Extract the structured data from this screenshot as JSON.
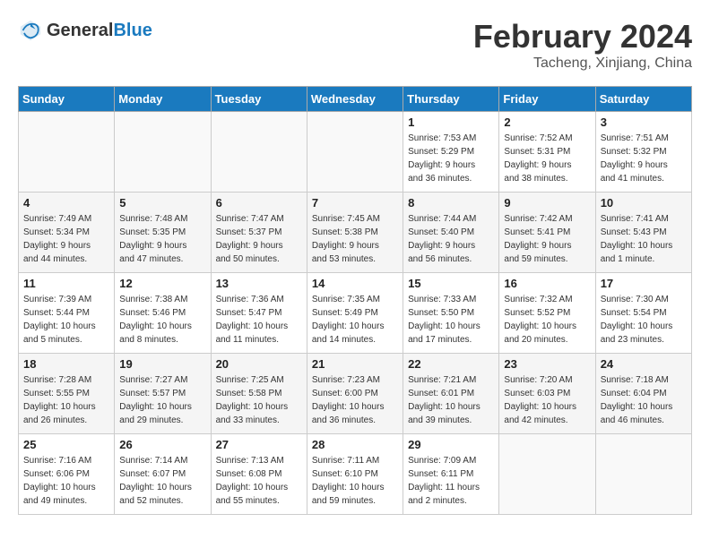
{
  "header": {
    "logo_general": "General",
    "logo_blue": "Blue",
    "month_title": "February 2024",
    "location": "Tacheng, Xinjiang, China"
  },
  "days_of_week": [
    "Sunday",
    "Monday",
    "Tuesday",
    "Wednesday",
    "Thursday",
    "Friday",
    "Saturday"
  ],
  "weeks": [
    [
      {
        "day": "",
        "info": ""
      },
      {
        "day": "",
        "info": ""
      },
      {
        "day": "",
        "info": ""
      },
      {
        "day": "",
        "info": ""
      },
      {
        "day": "1",
        "info": "Sunrise: 7:53 AM\nSunset: 5:29 PM\nDaylight: 9 hours\nand 36 minutes."
      },
      {
        "day": "2",
        "info": "Sunrise: 7:52 AM\nSunset: 5:31 PM\nDaylight: 9 hours\nand 38 minutes."
      },
      {
        "day": "3",
        "info": "Sunrise: 7:51 AM\nSunset: 5:32 PM\nDaylight: 9 hours\nand 41 minutes."
      }
    ],
    [
      {
        "day": "4",
        "info": "Sunrise: 7:49 AM\nSunset: 5:34 PM\nDaylight: 9 hours\nand 44 minutes."
      },
      {
        "day": "5",
        "info": "Sunrise: 7:48 AM\nSunset: 5:35 PM\nDaylight: 9 hours\nand 47 minutes."
      },
      {
        "day": "6",
        "info": "Sunrise: 7:47 AM\nSunset: 5:37 PM\nDaylight: 9 hours\nand 50 minutes."
      },
      {
        "day": "7",
        "info": "Sunrise: 7:45 AM\nSunset: 5:38 PM\nDaylight: 9 hours\nand 53 minutes."
      },
      {
        "day": "8",
        "info": "Sunrise: 7:44 AM\nSunset: 5:40 PM\nDaylight: 9 hours\nand 56 minutes."
      },
      {
        "day": "9",
        "info": "Sunrise: 7:42 AM\nSunset: 5:41 PM\nDaylight: 9 hours\nand 59 minutes."
      },
      {
        "day": "10",
        "info": "Sunrise: 7:41 AM\nSunset: 5:43 PM\nDaylight: 10 hours\nand 1 minute."
      }
    ],
    [
      {
        "day": "11",
        "info": "Sunrise: 7:39 AM\nSunset: 5:44 PM\nDaylight: 10 hours\nand 5 minutes."
      },
      {
        "day": "12",
        "info": "Sunrise: 7:38 AM\nSunset: 5:46 PM\nDaylight: 10 hours\nand 8 minutes."
      },
      {
        "day": "13",
        "info": "Sunrise: 7:36 AM\nSunset: 5:47 PM\nDaylight: 10 hours\nand 11 minutes."
      },
      {
        "day": "14",
        "info": "Sunrise: 7:35 AM\nSunset: 5:49 PM\nDaylight: 10 hours\nand 14 minutes."
      },
      {
        "day": "15",
        "info": "Sunrise: 7:33 AM\nSunset: 5:50 PM\nDaylight: 10 hours\nand 17 minutes."
      },
      {
        "day": "16",
        "info": "Sunrise: 7:32 AM\nSunset: 5:52 PM\nDaylight: 10 hours\nand 20 minutes."
      },
      {
        "day": "17",
        "info": "Sunrise: 7:30 AM\nSunset: 5:54 PM\nDaylight: 10 hours\nand 23 minutes."
      }
    ],
    [
      {
        "day": "18",
        "info": "Sunrise: 7:28 AM\nSunset: 5:55 PM\nDaylight: 10 hours\nand 26 minutes."
      },
      {
        "day": "19",
        "info": "Sunrise: 7:27 AM\nSunset: 5:57 PM\nDaylight: 10 hours\nand 29 minutes."
      },
      {
        "day": "20",
        "info": "Sunrise: 7:25 AM\nSunset: 5:58 PM\nDaylight: 10 hours\nand 33 minutes."
      },
      {
        "day": "21",
        "info": "Sunrise: 7:23 AM\nSunset: 6:00 PM\nDaylight: 10 hours\nand 36 minutes."
      },
      {
        "day": "22",
        "info": "Sunrise: 7:21 AM\nSunset: 6:01 PM\nDaylight: 10 hours\nand 39 minutes."
      },
      {
        "day": "23",
        "info": "Sunrise: 7:20 AM\nSunset: 6:03 PM\nDaylight: 10 hours\nand 42 minutes."
      },
      {
        "day": "24",
        "info": "Sunrise: 7:18 AM\nSunset: 6:04 PM\nDaylight: 10 hours\nand 46 minutes."
      }
    ],
    [
      {
        "day": "25",
        "info": "Sunrise: 7:16 AM\nSunset: 6:06 PM\nDaylight: 10 hours\nand 49 minutes."
      },
      {
        "day": "26",
        "info": "Sunrise: 7:14 AM\nSunset: 6:07 PM\nDaylight: 10 hours\nand 52 minutes."
      },
      {
        "day": "27",
        "info": "Sunrise: 7:13 AM\nSunset: 6:08 PM\nDaylight: 10 hours\nand 55 minutes."
      },
      {
        "day": "28",
        "info": "Sunrise: 7:11 AM\nSunset: 6:10 PM\nDaylight: 10 hours\nand 59 minutes."
      },
      {
        "day": "29",
        "info": "Sunrise: 7:09 AM\nSunset: 6:11 PM\nDaylight: 11 hours\nand 2 minutes."
      },
      {
        "day": "",
        "info": ""
      },
      {
        "day": "",
        "info": ""
      }
    ]
  ]
}
